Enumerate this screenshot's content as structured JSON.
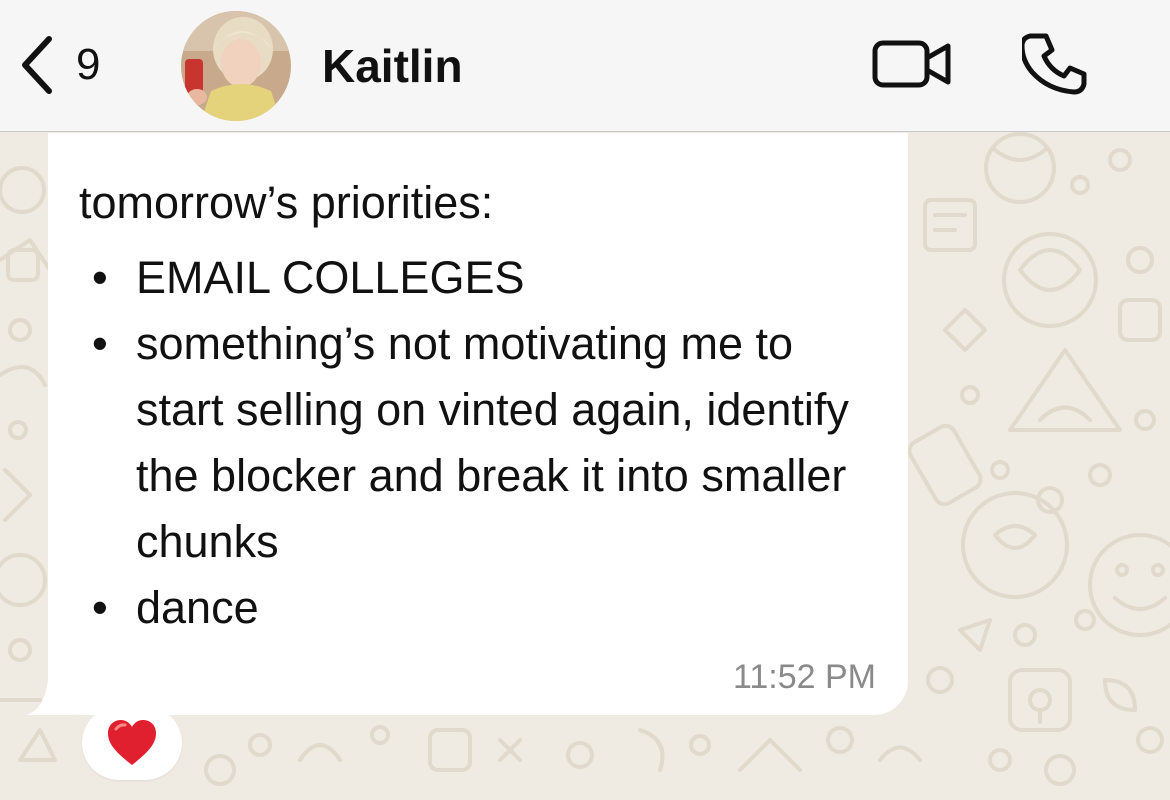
{
  "header": {
    "back_count": "9",
    "contact_name": "Kaitlin"
  },
  "message": {
    "heading": "tomorrow’s priorities:",
    "items": [
      "EMAIL COLLEGES",
      "something’s not motivating me to start selling on vinted again, identify the blocker and break it into smaller chunks",
      "dance"
    ],
    "bullet": "•",
    "time": "11:52 PM",
    "reaction": "heart"
  },
  "colors": {
    "wallpaper": "#efeae2",
    "header_bg": "#f6f6f6",
    "bubble_bg": "#ffffff",
    "timestamp": "#8a8a8a",
    "reaction_heart": "#e0202e"
  }
}
